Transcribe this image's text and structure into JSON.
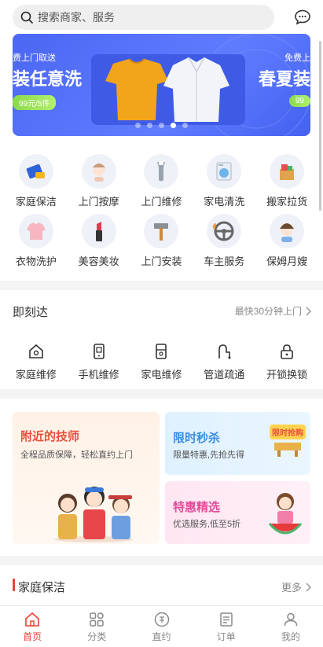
{
  "search": {
    "placeholder": "搜索商家、服务"
  },
  "icons": {
    "search": "search-icon",
    "message": "chat-bubble-icon"
  },
  "banner": {
    "left_small": "费上门取送",
    "left_big": "装任意洗",
    "left_price": "99元/5件",
    "right_small": "免费上",
    "right_big": "春夏装",
    "right_price": "99",
    "dot_count": 5,
    "active_dot_index": 3
  },
  "categories": [
    {
      "label": "家庭保洁",
      "icon": "cleaning-icon"
    },
    {
      "label": "上门按摩",
      "icon": "massage-icon"
    },
    {
      "label": "上门维修",
      "icon": "wrench-icon"
    },
    {
      "label": "家电清洗",
      "icon": "washing-machine-icon"
    },
    {
      "label": "搬家拉货",
      "icon": "moving-box-icon"
    },
    {
      "label": "衣物洗护",
      "icon": "shirt-icon"
    },
    {
      "label": "美容美妆",
      "icon": "lipstick-icon"
    },
    {
      "label": "上门安装",
      "icon": "hammer-icon"
    },
    {
      "label": "车主服务",
      "icon": "steering-wheel-icon"
    },
    {
      "label": "保姆月嫂",
      "icon": "nanny-icon"
    }
  ],
  "instant": {
    "title": "即刻达",
    "right_text": "最快30分钟上门",
    "items": [
      {
        "label": "家庭维修",
        "icon": "house-icon"
      },
      {
        "label": "手机维修",
        "icon": "phone-icon"
      },
      {
        "label": "家电维修",
        "icon": "fridge-icon"
      },
      {
        "label": "管道疏通",
        "icon": "pipe-icon"
      },
      {
        "label": "开锁换锁",
        "icon": "lock-icon"
      }
    ]
  },
  "promos": {
    "nearby": {
      "title": "附近的技师",
      "subtitle": "全程品质保障，轻松直约上门"
    },
    "flash": {
      "title": "限时秒杀",
      "subtitle": "限量特惠,先抢先得",
      "badge": "限时抢购"
    },
    "picks": {
      "title": "特惠精选",
      "subtitle": "优选服务,低至5折"
    }
  },
  "cleaning_section": {
    "title": "家庭保洁",
    "more": "更多"
  },
  "bottom_nav": [
    {
      "label": "首页",
      "icon": "home-icon",
      "active": true
    },
    {
      "label": "分类",
      "icon": "grid-icon",
      "active": false
    },
    {
      "label": "直约",
      "icon": "appointment-icon",
      "active": false
    },
    {
      "label": "订单",
      "icon": "order-icon",
      "active": false
    },
    {
      "label": "我的",
      "icon": "user-icon",
      "active": false
    }
  ],
  "colors": {
    "accent": "#e94235",
    "banner_blue": "#4b67f3",
    "nearby_title": "#e8503d",
    "flash_title": "#3a8ee6",
    "picks_title": "#e24c9a"
  }
}
